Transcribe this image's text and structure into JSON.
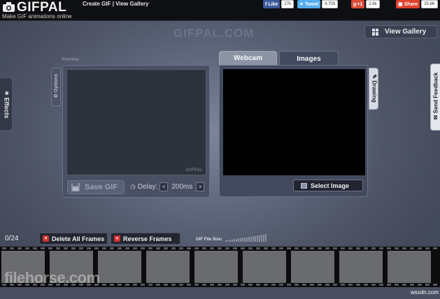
{
  "header": {
    "logo_text": "GIFPAL",
    "tagline": "Make GIF animations online",
    "nav_create": "Create GIF",
    "nav_sep": " | ",
    "nav_gallery": "View Gallery"
  },
  "social": {
    "facebook": {
      "label": "Like",
      "count": "27k"
    },
    "twitter": {
      "label": "Tweet",
      "count": "4,703"
    },
    "gplus": {
      "label": "+1",
      "count": "2.6k"
    },
    "share": {
      "label": "Share",
      "count": "25.6K"
    }
  },
  "watermark_title": "GIFPAL.COM",
  "view_gallery_button": "View Gallery",
  "side_tabs": {
    "effects": "Effects",
    "options": "Options",
    "drawing": "Drawing",
    "feedback": "Send Feedback"
  },
  "preview": {
    "label": "Preview",
    "watermark": "GIFPAL",
    "save_button": "Save GIF",
    "delay_label": "Delay:",
    "delay_value": "200ms",
    "delay_dec": "<",
    "delay_inc": ">"
  },
  "source_tabs": {
    "webcam": "Webcam",
    "images": "Images",
    "active": "Images"
  },
  "select_image_button": "Select Image",
  "frames": {
    "counter": "0/24",
    "delete_all": "Delete All Frames",
    "reverse": "Reverse Frames",
    "file_size_label": "GIF File Size:",
    "file_size_level": 0
  },
  "watermarks": {
    "filehorse": "filehorse.com",
    "wsxdn": "wsxdn.com"
  },
  "colors": {
    "facebook": "#3b5998",
    "twitter": "#55acee",
    "gplus": "#dd4b39",
    "share": "#e0412c",
    "accent_red": "#d43030"
  },
  "icons": {
    "logo": "camera-icon",
    "gallery": "grid-icon",
    "save": "floppy-disk-icon",
    "delay": "clock-icon",
    "select_image": "image-icon",
    "delete": "x-icon",
    "reverse": "reverse-arrows-icon"
  }
}
